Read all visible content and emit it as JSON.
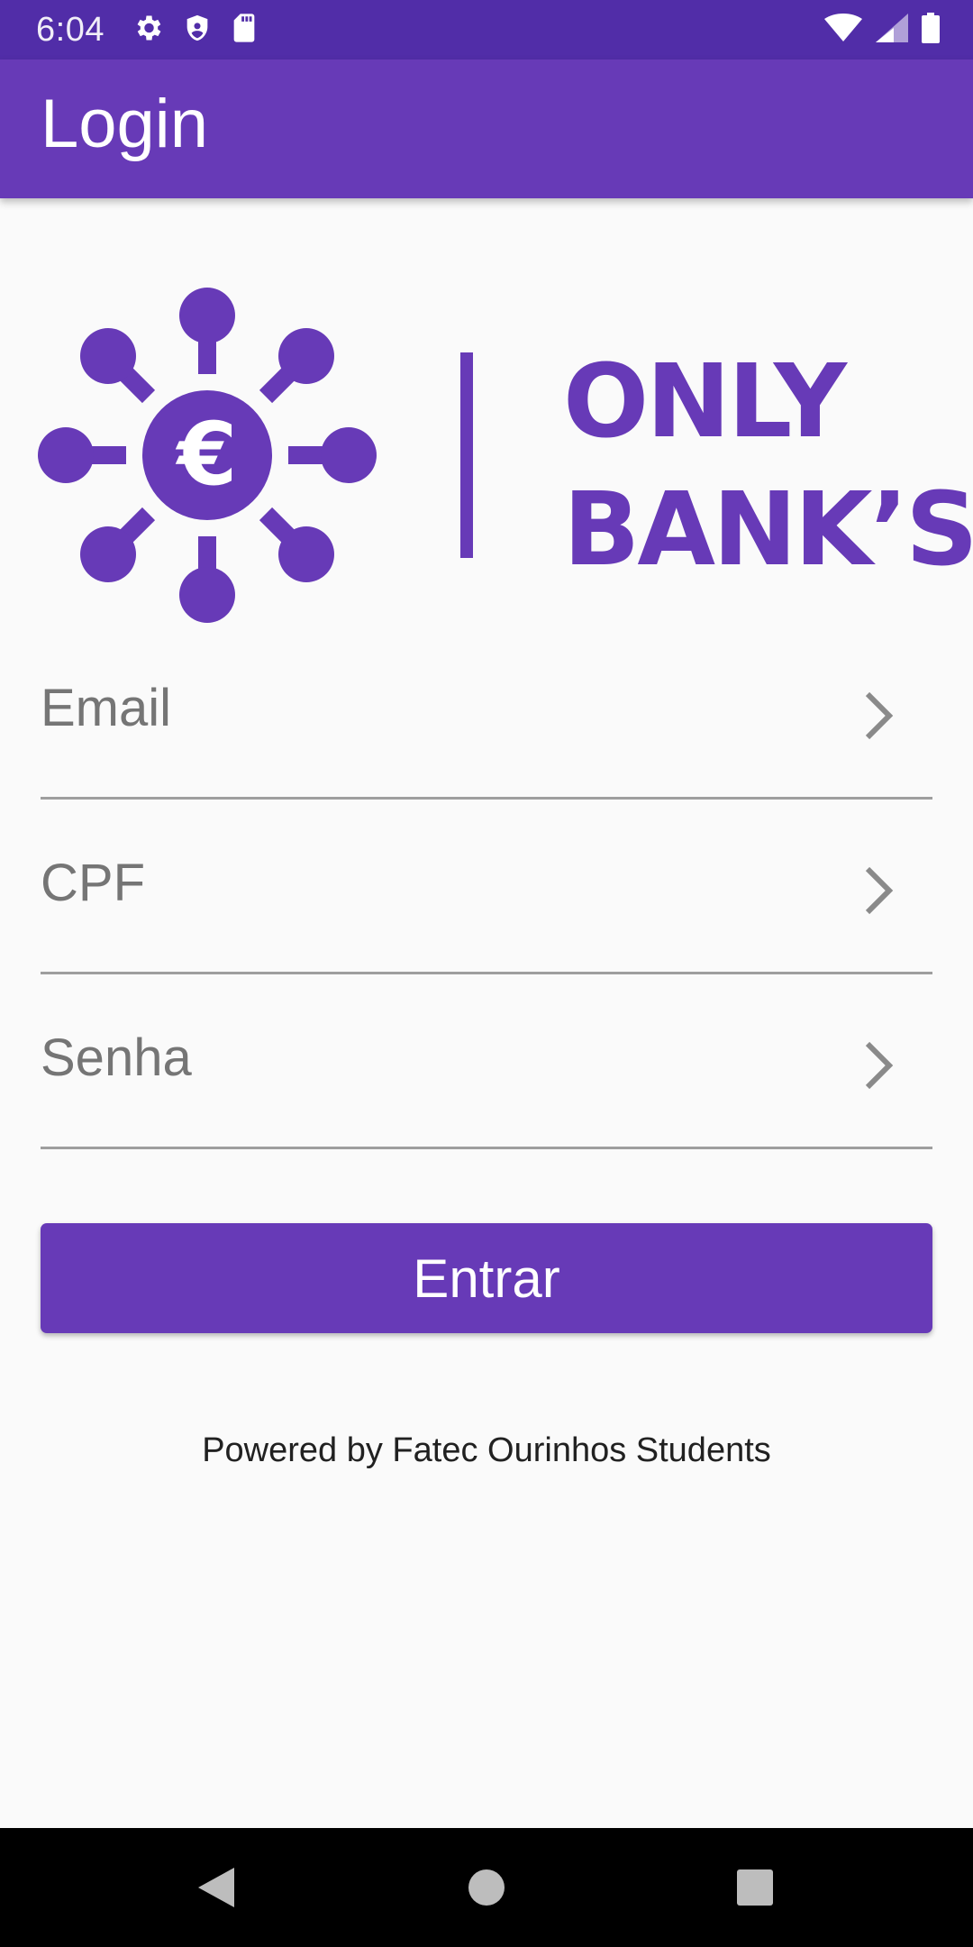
{
  "status_bar": {
    "time": "6:04",
    "left_icons": [
      "gear-icon",
      "shield-icon",
      "sd-card-icon"
    ],
    "right_icons": [
      "wifi-icon",
      "cell-signal-icon",
      "battery-icon"
    ]
  },
  "app_bar": {
    "title": "Login",
    "color": "#673ab7"
  },
  "logo": {
    "icon": "euro-network-icon",
    "line1": "ONLY",
    "line2": "BANK’S",
    "color": "#673ab7"
  },
  "form": {
    "email_label": "Email",
    "cpf_label": "CPF",
    "senha_label": "Senha",
    "submit_label": "Entrar"
  },
  "footer": {
    "text": "Powered by Fatec Ourinhos Students"
  },
  "nav_bar": {
    "buttons": [
      "back-icon",
      "home-icon",
      "recents-icon"
    ]
  }
}
